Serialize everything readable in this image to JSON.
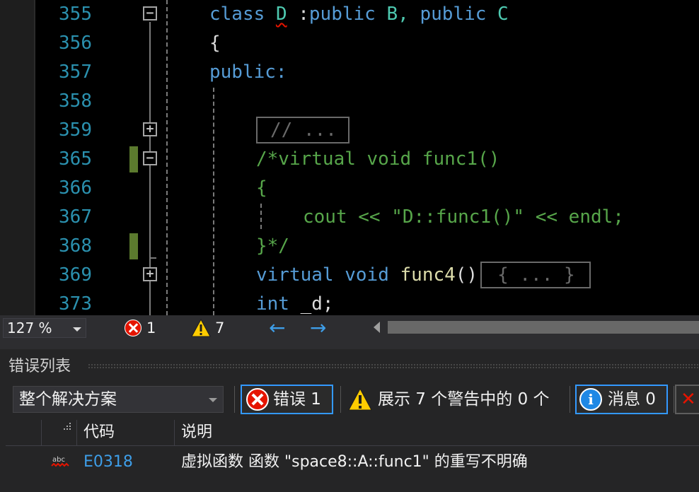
{
  "editor": {
    "lines": [
      {
        "no": "355",
        "fold": "minus",
        "change": false
      },
      {
        "no": "356",
        "fold": "",
        "change": false
      },
      {
        "no": "357",
        "fold": "",
        "change": false
      },
      {
        "no": "358",
        "fold": "",
        "change": false
      },
      {
        "no": "359",
        "fold": "plus",
        "change": false
      },
      {
        "no": "365",
        "fold": "minus",
        "change": true
      },
      {
        "no": "366",
        "fold": "",
        "change": false
      },
      {
        "no": "367",
        "fold": "",
        "change": false
      },
      {
        "no": "368",
        "fold": "",
        "change": true
      },
      {
        "no": "369",
        "fold": "plus",
        "change": false
      },
      {
        "no": "373",
        "fold": "",
        "change": false
      }
    ],
    "code": {
      "l355_kw": "class",
      "l355_name": "D",
      "l355_rest1": " :",
      "l355_public1": "public",
      "l355_b": " B,",
      "l355_public2": " public",
      "l355_c": " C",
      "l356": "{",
      "l357": "public:",
      "l359_collapsed": "// ...",
      "l365": "/*virtual void func1()",
      "l366": "{",
      "l367": "cout << \"D::func1()\" << endl;",
      "l368": "}*/",
      "l369_kw1": "virtual",
      "l369_kw2": " void",
      "l369_fn": " func4",
      "l369_paren": "()",
      "l369_collapsed": "{ ... }",
      "l373_kw": "int",
      "l373_rest": " _d;"
    },
    "colors": {
      "keyword": "#569cd6",
      "type": "#4ec9b0",
      "function": "#dcdcaa",
      "comment": "#57a64a",
      "line_number": "#2b91af",
      "error": "#e51400",
      "change_bar": "#5b7a2e"
    }
  },
  "statusbar": {
    "zoom": "127 %",
    "error_count": "1",
    "warning_count": "7",
    "nav_back": "←",
    "nav_forward": "→"
  },
  "error_list": {
    "title": "错误列表",
    "scope": "整个解决方案",
    "errors_label": "错误 1",
    "warnings_label": "展示 7 个警告中的 0 个",
    "messages_label": "消息 0",
    "columns": {
      "code": "代码",
      "description": "说明"
    },
    "rows": [
      {
        "icon": "spelling-error-icon",
        "code": "E0318",
        "description": "虚拟函数 函数 \"space8::A::func1\" 的重写不明确"
      }
    ]
  }
}
